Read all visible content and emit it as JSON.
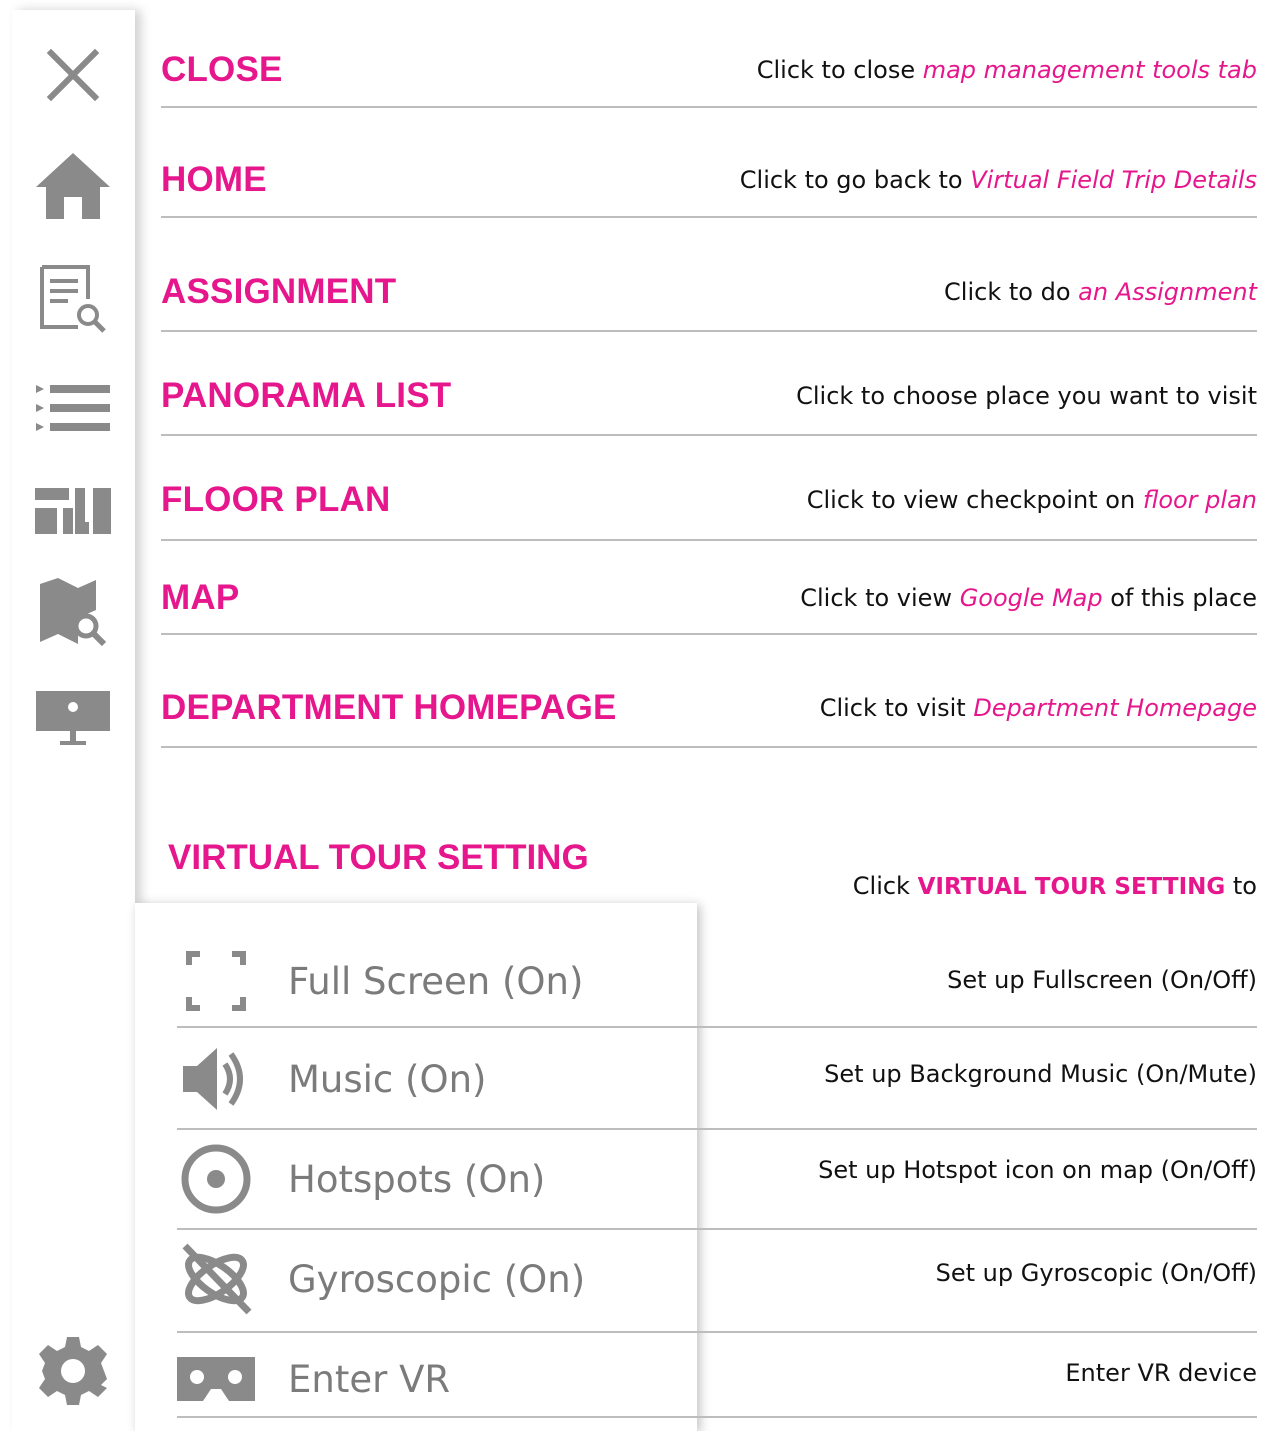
{
  "sidebar": {
    "icons": [
      "close-icon",
      "home-icon",
      "assignment-icon",
      "list-icon",
      "floor-plan-icon",
      "map-icon",
      "department-homepage-icon",
      "settings-gear-icon"
    ]
  },
  "menu": {
    "items": [
      {
        "title": "CLOSE",
        "desc_prefix": "Click to close ",
        "desc_highlight": "map management tools tab",
        "desc_suffix": ""
      },
      {
        "title": "HOME",
        "desc_prefix": "Click to go back to ",
        "desc_highlight": "Virtual Field Trip Details",
        "desc_suffix": ""
      },
      {
        "title": "ASSIGNMENT",
        "desc_prefix": "Click to do ",
        "desc_highlight": "an Assignment",
        "desc_suffix": ""
      },
      {
        "title": "PANORAMA LIST",
        "desc_prefix": "Click to choose place you want to visit",
        "desc_highlight": "",
        "desc_suffix": ""
      },
      {
        "title": "FLOOR PLAN",
        "desc_prefix": "Click to view checkpoint on ",
        "desc_highlight": "floor plan",
        "desc_suffix": ""
      },
      {
        "title": "MAP",
        "desc_prefix": "Click to view ",
        "desc_highlight": "Google Map",
        "desc_suffix": " of this place"
      },
      {
        "title": "DEPARTMENT HOMEPAGE",
        "desc_prefix": "Click to visit ",
        "desc_highlight": "Department Homepage",
        "desc_suffix": ""
      }
    ]
  },
  "virtual_tour": {
    "title": "VIRTUAL TOUR SETTING",
    "click_prefix": "Click ",
    "click_bold": "VIRTUAL TOUR SETTING",
    "click_suffix": " to",
    "settings": [
      {
        "label": "Full Screen (On)",
        "desc": "Set up Fullscreen (On/Off)"
      },
      {
        "label": "Music (On)",
        "desc": "Set up Background Music (On/Mute)"
      },
      {
        "label": "Hotspots (On)",
        "desc": "Set up Hotspot icon on map (On/Off)"
      },
      {
        "label": "Gyroscopic (On)",
        "desc": "Set up Gyroscopic (On/Off)"
      },
      {
        "label": "Enter VR",
        "desc": "Enter VR device"
      }
    ]
  },
  "colors": {
    "accent": "#e6168c",
    "icon_gray": "#8a8a8a",
    "divider": "#bdbdbd"
  }
}
